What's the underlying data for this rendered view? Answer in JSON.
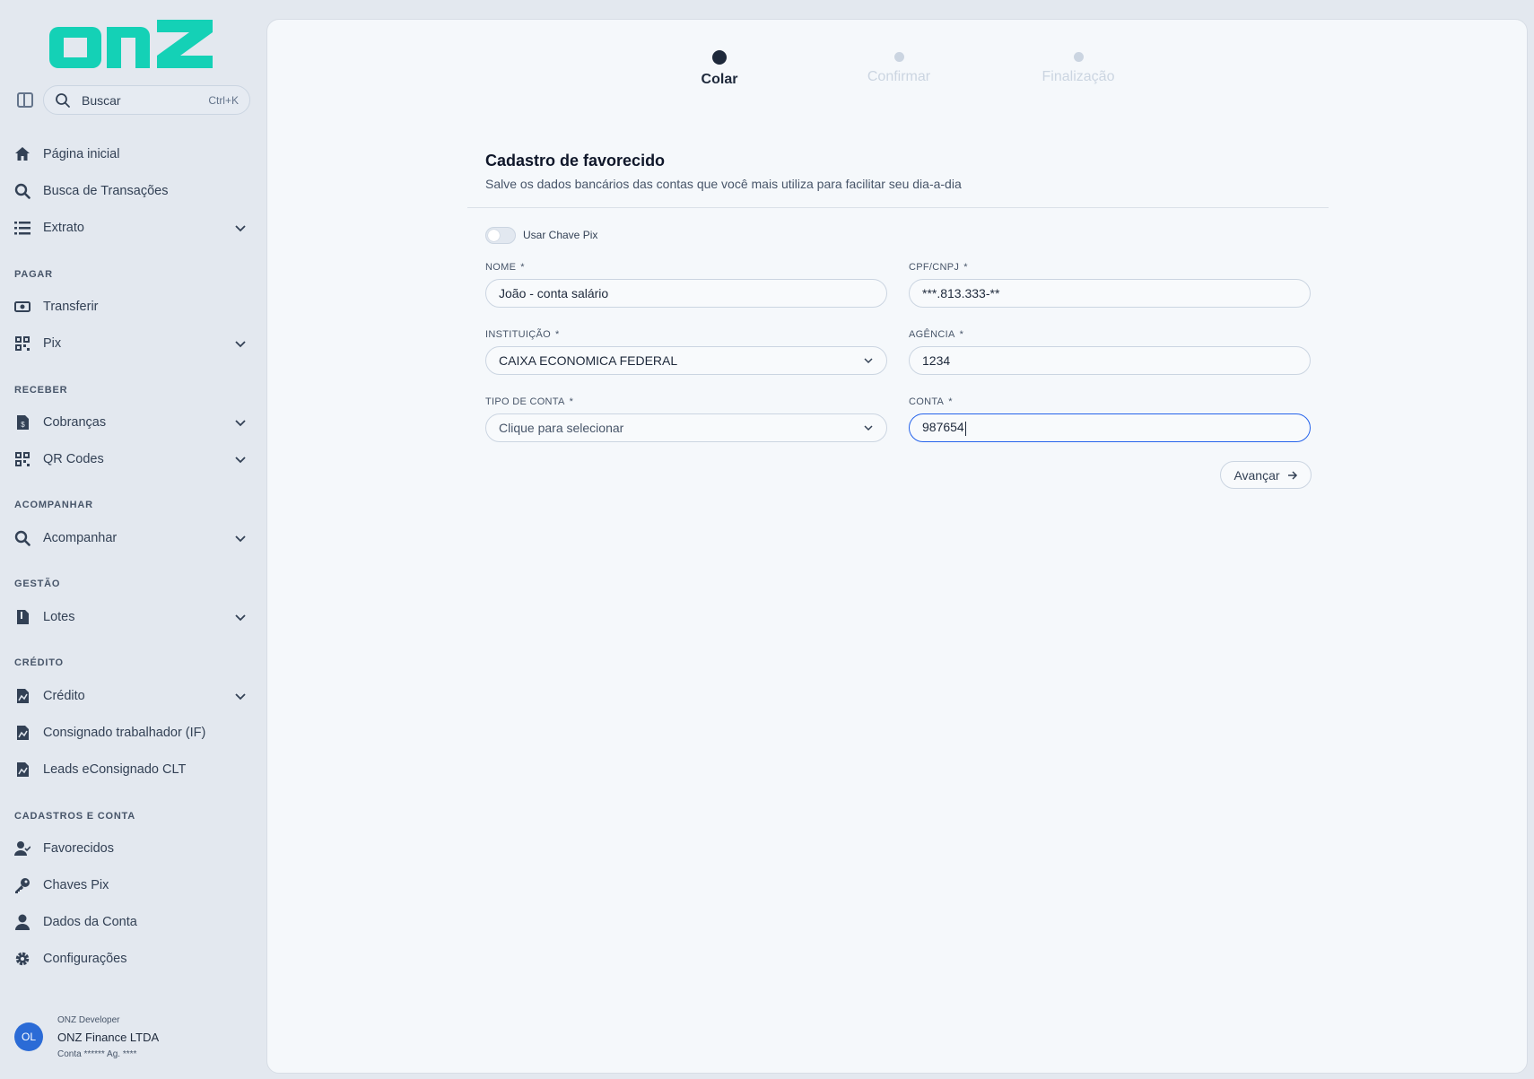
{
  "brand": {
    "logo_text": "onz",
    "color": "#14d1b6"
  },
  "search": {
    "label": "Buscar",
    "shortcut": "Ctrl+K"
  },
  "nav": {
    "home": "Página inicial",
    "busca": "Busca de Transações",
    "extrato": "Extrato",
    "sec_pagar": "PAGAR",
    "transferir": "Transferir",
    "pix": "Pix",
    "sec_receber": "RECEBER",
    "cobrancas": "Cobranças",
    "qrcodes": "QR Codes",
    "sec_acompanhar": "ACOMPANHAR",
    "acompanhar": "Acompanhar",
    "sec_gestao": "GESTÃO",
    "lotes": "Lotes",
    "sec_credito": "CRÉDITO",
    "credito": "Crédito",
    "consignado": "Consignado trabalhador (IF)",
    "leads": "Leads eConsignado CLT",
    "sec_cadastros": "CADASTROS E CONTA",
    "favorecidos": "Favorecidos",
    "chaves": "Chaves Pix",
    "dados": "Dados da Conta",
    "config": "Configurações"
  },
  "user": {
    "initials": "OL",
    "role": "ONZ Developer",
    "company": "ONZ Finance LTDA",
    "account": "Conta ****** Ag. ****"
  },
  "steps": [
    {
      "label": "Colar",
      "state": "active"
    },
    {
      "label": "Confirmar",
      "state": "inactive"
    },
    {
      "label": "Finalização",
      "state": "inactive"
    }
  ],
  "form": {
    "title": "Cadastro de favorecido",
    "subtitle": "Salve os dados bancários das contas que você mais utiliza para facilitar seu dia-a-dia",
    "toggle_label": "Usar Chave Pix",
    "nome_label": "NOME",
    "nome_value": "João - conta salário",
    "cpf_label": "CPF/CNPJ",
    "cpf_value": "***.813.333-**",
    "inst_label": "INSTITUIÇÃO",
    "inst_value": "CAIXA ECONOMICA FEDERAL",
    "agencia_label": "AGÊNCIA",
    "agencia_value": "1234",
    "tipo_label": "TIPO DE CONTA",
    "tipo_placeholder": "Clique para selecionar",
    "conta_label": "CONTA",
    "conta_value": "987654",
    "required_mark": "*",
    "next_label": "Avançar"
  }
}
